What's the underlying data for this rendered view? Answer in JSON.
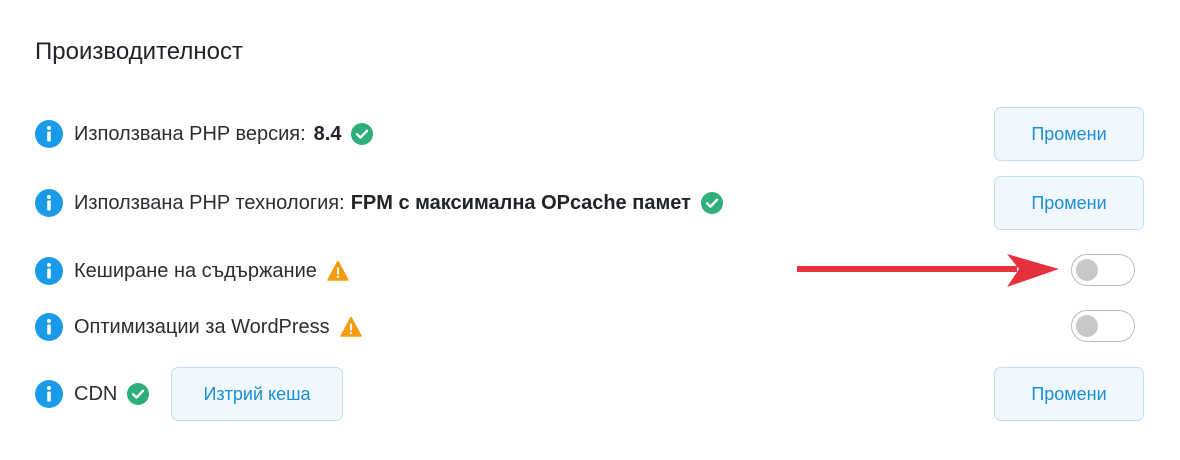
{
  "section": {
    "title": "Производителност"
  },
  "rows": {
    "php_version": {
      "label": "Използвана PHP версия:",
      "value": "8.4",
      "status_icon": "check-circle-icon",
      "button": "Промени"
    },
    "php_tech": {
      "label": "Използвана PHP технология:",
      "value": "FPM с максимална OPcache памет",
      "status_icon": "check-circle-icon",
      "button": "Промени"
    },
    "content_cache": {
      "label": "Кеширане на съдържание",
      "status_icon": "warning-triangle-icon",
      "toggle_on": false
    },
    "wp_optimizations": {
      "label": "Оптимизации за WordPress",
      "status_icon": "warning-triangle-icon",
      "toggle_on": false
    },
    "cdn": {
      "label": "CDN",
      "status_icon": "check-circle-icon",
      "clear_cache_button": "Изтрий кеша",
      "button": "Промени"
    }
  },
  "colors": {
    "info_blue": "#1a9be9",
    "success_green": "#2eae7a",
    "warning_orange": "#f39c12",
    "button_text": "#1a8ed6",
    "arrow_red": "#e6323c"
  }
}
